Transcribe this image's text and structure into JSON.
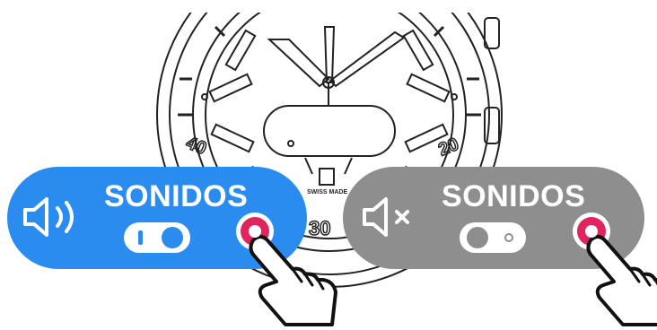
{
  "watch": {
    "dial_text": "SWISS MADE",
    "bezel_numbers": [
      "40",
      "30",
      "20"
    ]
  },
  "sound_on": {
    "label": "SONIDOS",
    "state": "on",
    "icon": "speaker-sound-icon",
    "accent": "#2b8cf0"
  },
  "sound_off": {
    "label": "SONIDOS",
    "state": "off",
    "icon": "speaker-muted-icon",
    "accent": "#8e8e8e"
  },
  "press_marker_color": "#e0245e"
}
